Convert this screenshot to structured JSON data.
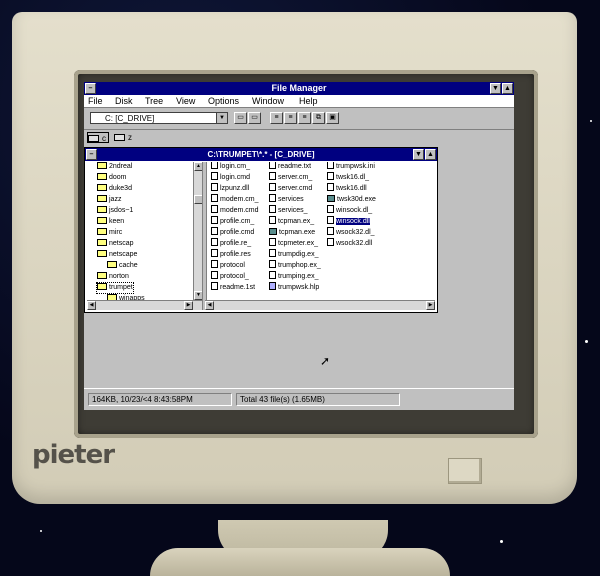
{
  "brand": "pieter",
  "window": {
    "title": "File Manager",
    "menu": [
      "File",
      "Disk",
      "Tree",
      "View",
      "Options",
      "Window",
      "Help"
    ]
  },
  "toolbar": {
    "drive_select": "C: [C_DRIVE]",
    "drives": [
      "c",
      "z"
    ]
  },
  "child_window": {
    "title": "C:\\TRUMPET\\*.* - [C_DRIVE]"
  },
  "tree": {
    "items": [
      "2ndreal",
      "doom",
      "duke3d",
      "jazz",
      "jsdos~1",
      "keen",
      "mirc",
      "netscap",
      "netscape",
      "cache",
      "norton",
      "trumpet",
      "winapps"
    ],
    "selected": "trumpet"
  },
  "files": {
    "column1": [
      "login.cm_",
      "login.cmd",
      "lzpunz.dll",
      "modem.cm_",
      "modem.cmd",
      "profile.cm_",
      "profile.cmd",
      "profile.re_",
      "profile.res",
      "protocol",
      "protocol_",
      "readme.1st"
    ],
    "column2": [
      "readme.txt",
      "server.cm_",
      "server.cmd",
      "services",
      "services_",
      "tcpman.ex_",
      "tcpman.exe",
      "tcpmeter.ex_",
      "trumpdig.ex_",
      "trumphop.ex_",
      "trumping.ex_",
      "trumpwsk.hlp"
    ],
    "column3": [
      "trumpwsk.ini",
      "twsk16.dl_",
      "twsk16.dll",
      "twsk30d.exe",
      "winsock.dl_",
      "winsock.dll",
      "wsock32.dl_",
      "wsock32.dll"
    ],
    "highlighted": "winsock.dll"
  },
  "status": {
    "left": "164KB, 10/23/<4 8:43:58PM",
    "right": "Total 43 file(s) (1.65MB)"
  }
}
